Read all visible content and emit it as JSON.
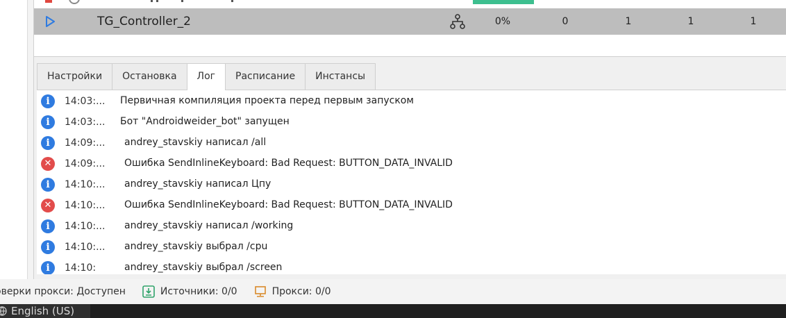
{
  "task_row": {
    "name": "TG_Controller_2",
    "progress": "0%",
    "col1": "0",
    "col2": "1",
    "col3": "1",
    "col4": "1"
  },
  "tabs": [
    {
      "label": "Настройки"
    },
    {
      "label": "Остановка"
    },
    {
      "label": "Лог"
    },
    {
      "label": "Расписание"
    },
    {
      "label": "Инстансы"
    }
  ],
  "active_tab": "Лог",
  "log": [
    {
      "level": "info",
      "time": "14:03:...",
      "message": "Первичная компиляция проекта перед первым запуском"
    },
    {
      "level": "info",
      "time": "14:03:...",
      "message": "Бот \"Androidweider_bot\" запущен"
    },
    {
      "level": "info",
      "time": "14:09:...",
      "message": "andrey_stavskiy написал /all"
    },
    {
      "level": "error",
      "time": "14:09:...",
      "message": "Ошибка SendInlineKeyboard: Bad Request: BUTTON_DATA_INVALID"
    },
    {
      "level": "info",
      "time": "14:10:...",
      "message": "andrey_stavskiy написал Цпу"
    },
    {
      "level": "error",
      "time": "14:10:...",
      "message": "Ошибка SendInlineKeyboard: Bad Request: BUTTON_DATA_INVALID"
    },
    {
      "level": "info",
      "time": "14:10:...",
      "message": "andrey_stavskiy написал /working"
    },
    {
      "level": "info",
      "time": "14:10:...",
      "message": "andrey_stavskiy выбрал /cpu"
    },
    {
      "level": "info",
      "time": "14:10:",
      "message": "andrey_stavskiy выбрал /screen"
    }
  ],
  "status": {
    "proxy_check": "оверки прокси: Доступен",
    "sources": "Источники: 0/0",
    "proxies": "Прокси: 0/0"
  },
  "taskbar": {
    "language": "English (US)"
  },
  "colors": {
    "selected_row": "#bdbdbd",
    "info": "#2f7be0",
    "error": "#e24c4b",
    "accent_green": "#3dbf8f",
    "play": "#2f7be0"
  }
}
